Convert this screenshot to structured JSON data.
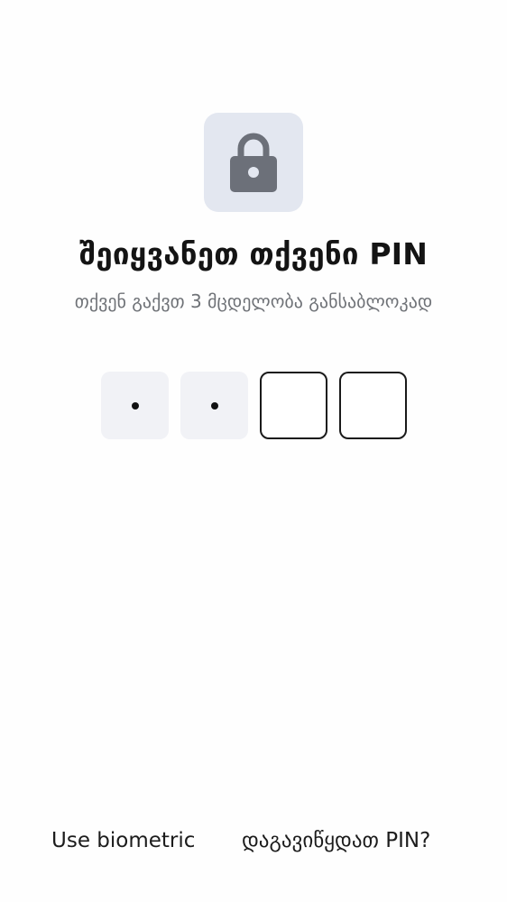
{
  "lock_screen": {
    "icon": "lock-icon",
    "title": "შეიყვანეთ თქვენი PIN",
    "subtitle": "თქვენ გაქვთ 3 მცდელობა განსაბლოკად"
  },
  "pin": {
    "length": 4,
    "entered": 2,
    "slots": [
      "filled",
      "filled",
      "empty",
      "empty"
    ]
  },
  "actions": {
    "biometric_label": "Use biometric",
    "forgot_label": "დაგავიწყდათ PIN?"
  },
  "colors": {
    "tile_bg": "#e3e7f0",
    "lock_icon": "#6c7079",
    "filled_slot": "#f1f2f6",
    "empty_slot_border": "#1a1a1a",
    "subtitle_text": "#6f7277"
  }
}
